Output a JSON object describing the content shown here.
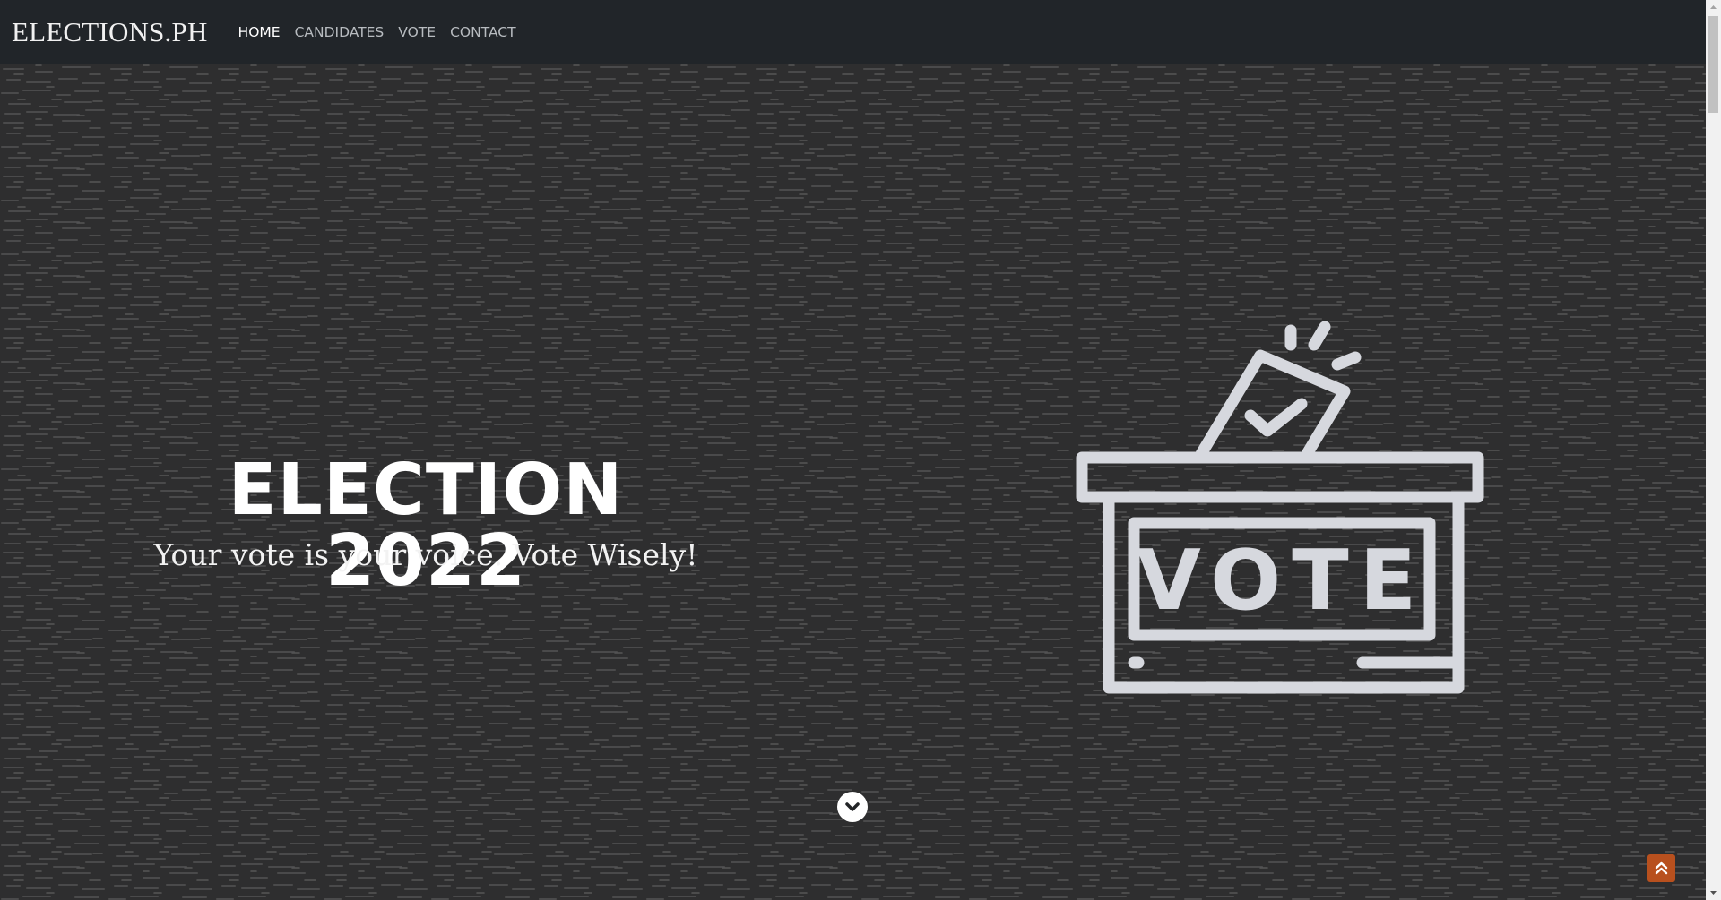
{
  "navbar": {
    "brand": "ELECTIONS.PH",
    "links": [
      {
        "label": "HOME",
        "active": true
      },
      {
        "label": "CANDIDATES",
        "active": false
      },
      {
        "label": "VOTE",
        "active": false
      },
      {
        "label": "CONTACT",
        "active": false
      }
    ]
  },
  "hero": {
    "title": "ELECTION 2022",
    "subtitle": "Your vote is your voice. Vote Wisely!",
    "ballot_label": "VOTE",
    "ballot_icon": "ballot-box-icon",
    "scroll_icon": "chevron-down-icon"
  },
  "back_to_top": {
    "icon": "double-chevron-up-icon",
    "color": "#b8501e"
  },
  "colors": {
    "navbar_bg": "#212529",
    "hero_bg": "#2e2e2f",
    "icon_stroke": "#d6d8de"
  }
}
